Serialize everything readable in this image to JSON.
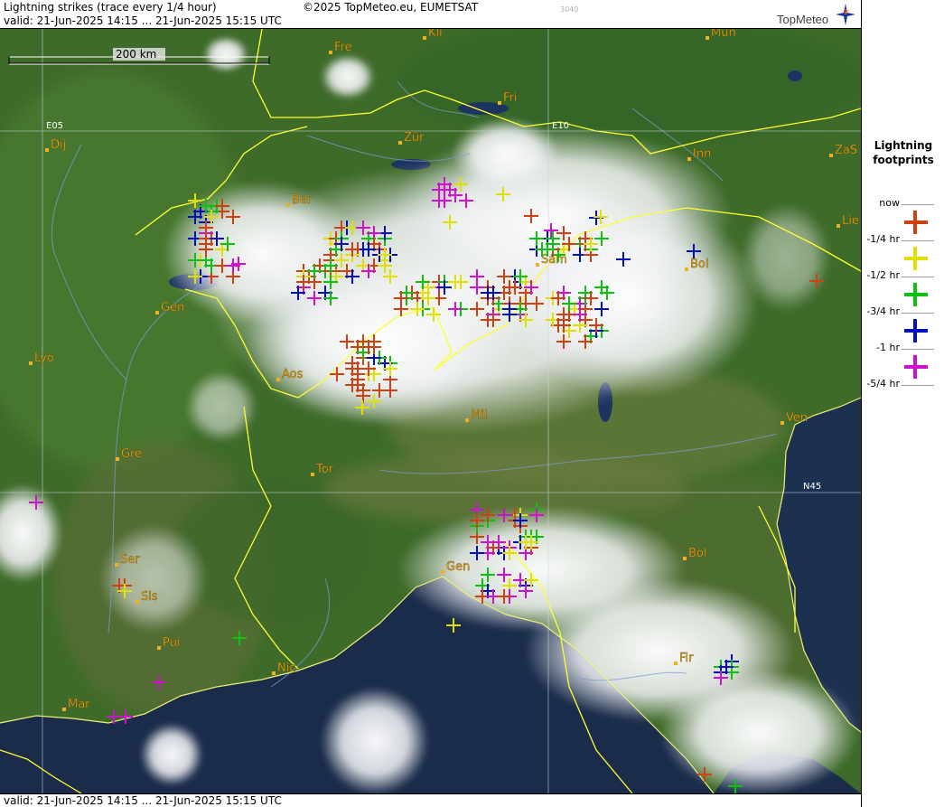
{
  "header": {
    "title": "Lightning strikes (trace every 1/4 hour)",
    "valid": "valid:  21-Jun-2025 14:15 ... 21-Jun-2025 15:15 UTC",
    "copyright": "©2025 TopMeteo.eu, EUMETSAT",
    "stamp": "3040",
    "brand": "TopMeteo"
  },
  "footer": {
    "valid": "valid:  21-Jun-2025 14:15 ... 21-Jun-2025 15:15 UTC"
  },
  "scale": {
    "label": "200 km"
  },
  "grid": {
    "lon": [
      "E05",
      "E10"
    ],
    "lat": [
      "N45"
    ]
  },
  "colors": {
    "now": "#d04010",
    "q1": "#e0e000",
    "q2": "#10c010",
    "q3": "#0010c0",
    "q4": "#d010d0"
  },
  "legend": {
    "title_line1": "Lightning",
    "title_line2": "footprints",
    "labels": [
      "now",
      "-1/4 hr",
      "-1/2 hr",
      "-3/4 hr",
      "-1 hr",
      "-5/4 hr"
    ]
  },
  "cities": [
    {
      "name": "Fre"
    },
    {
      "name": "Kli"
    },
    {
      "name": "Mün"
    },
    {
      "name": "Fri"
    },
    {
      "name": "Dij"
    },
    {
      "name": "Zür"
    },
    {
      "name": "Inn"
    },
    {
      "name": "ZaS"
    },
    {
      "name": "Ber"
    },
    {
      "name": "Lie"
    },
    {
      "name": "Sam"
    },
    {
      "name": "Bol"
    },
    {
      "name": "Gen"
    },
    {
      "name": "Lyo"
    },
    {
      "name": "Aos"
    },
    {
      "name": "Mil"
    },
    {
      "name": "Ven"
    },
    {
      "name": "Gre"
    },
    {
      "name": "Tor"
    },
    {
      "name": "Ser"
    },
    {
      "name": "Bol"
    },
    {
      "name": "Gen"
    },
    {
      "name": "Sis"
    },
    {
      "name": "Pui"
    },
    {
      "name": "Nic"
    },
    {
      "name": "Fir"
    },
    {
      "name": "Mar"
    }
  ]
}
